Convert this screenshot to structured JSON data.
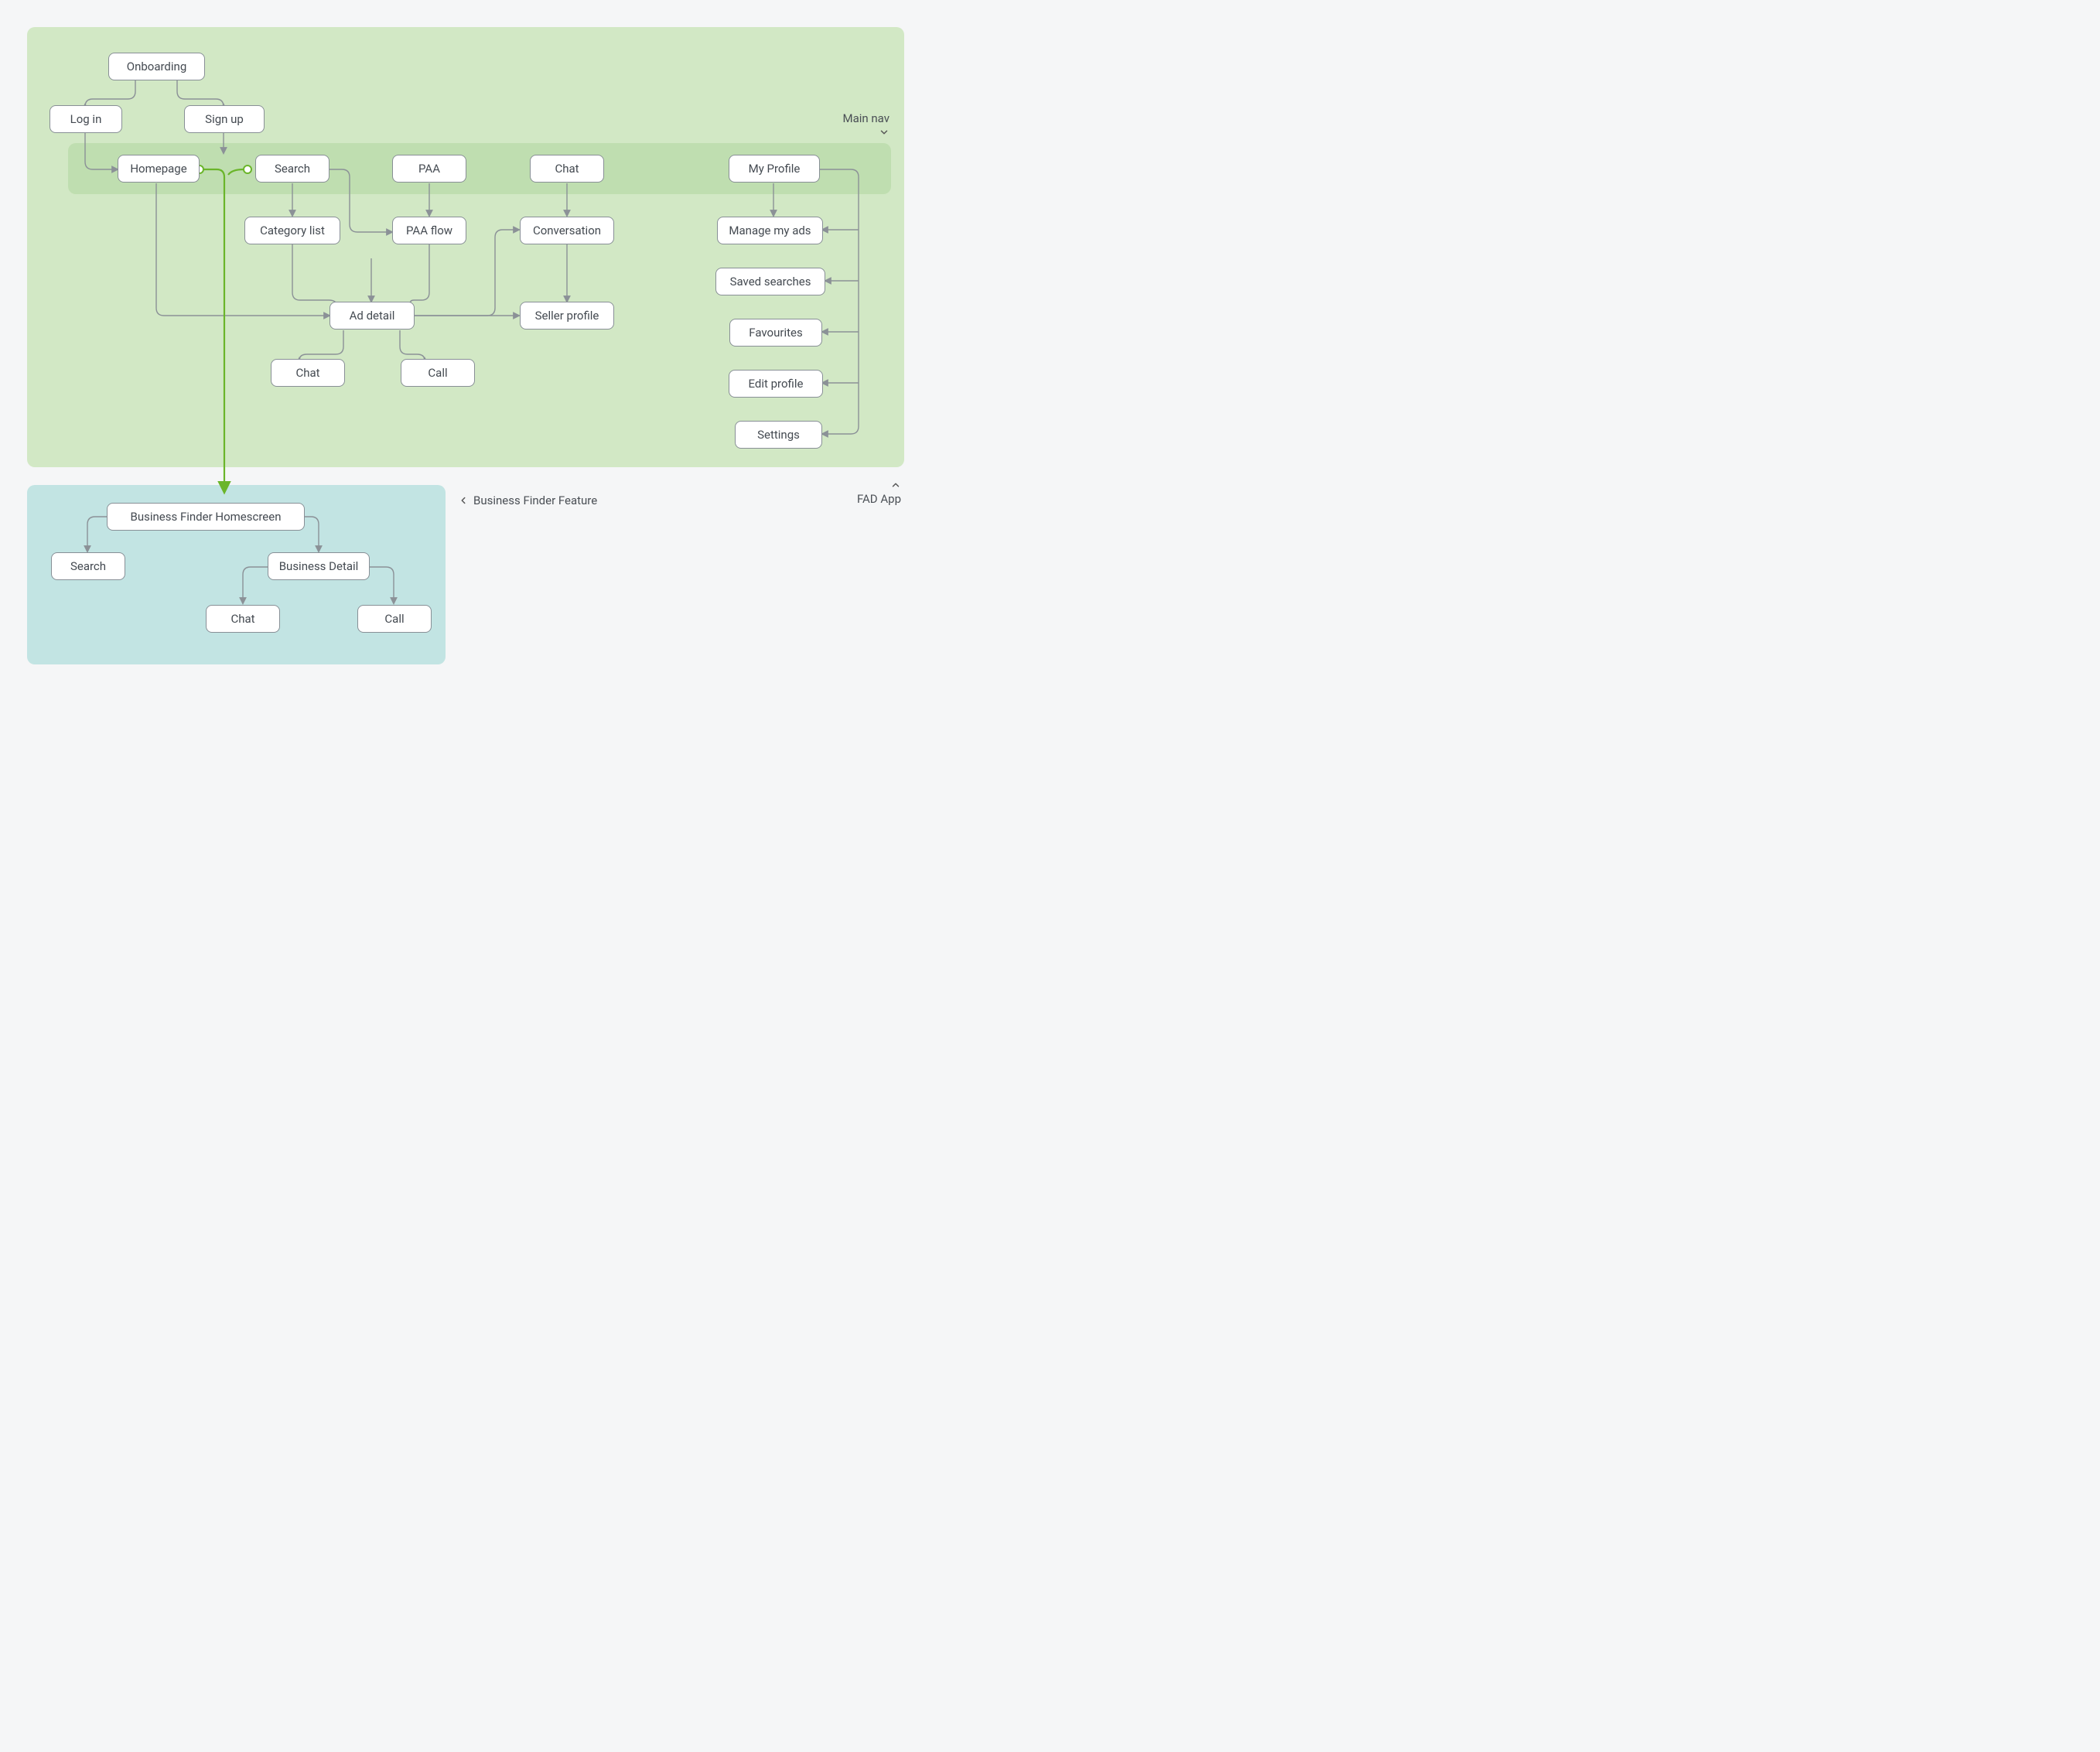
{
  "regions": {
    "fad_app_label": "FAD App",
    "main_nav_label": "Main nav",
    "business_finder_label": "Business Finder Feature"
  },
  "nodes": {
    "onboarding": "Onboarding",
    "login": "Log in",
    "signup": "Sign up",
    "homepage": "Homepage",
    "search": "Search",
    "paa": "PAA",
    "chat_nav": "Chat",
    "myprofile": "My Profile",
    "category_list": "Category list",
    "paa_flow": "PAA flow",
    "conversation": "Conversation",
    "manage_ads": "Manage my ads",
    "saved_searches": "Saved searches",
    "favourites": "Favourites",
    "edit_profile": "Edit profile",
    "settings": "Settings",
    "ad_detail": "Ad detail",
    "chat_sub": "Chat",
    "call_sub": "Call",
    "seller_profile": "Seller profile",
    "bf_home": "Business Finder Homescreen",
    "bf_search": "Search",
    "bf_detail": "Business Detail",
    "bf_chat": "Chat",
    "bf_call": "Call"
  }
}
